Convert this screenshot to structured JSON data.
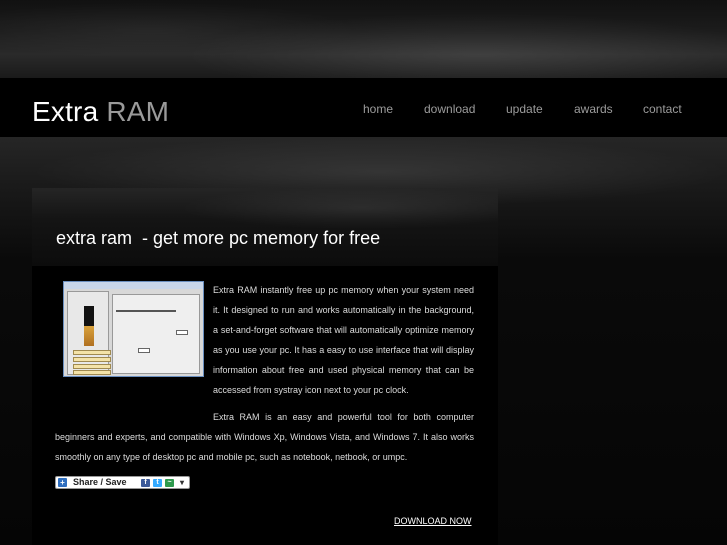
{
  "header": {
    "logo_part1": "Extra",
    "logo_part2": "RAM",
    "nav": [
      {
        "label": "home"
      },
      {
        "label": "download"
      },
      {
        "label": "update"
      },
      {
        "label": "awards"
      },
      {
        "label": "contact"
      }
    ]
  },
  "main": {
    "title": "extra ram  - get more pc memory for free",
    "paragraph1": "Extra RAM instantly free up pc memory when your system need it. It designed to run and works automatically in the background, a set-and-forget software that will automatically optimize memory as you use your pc. It has a easy to use interface that will display information about free and used physical memory that can be accessed from systray icon next to your pc clock.",
    "paragraph2_lead": "Extra RAM is an easy and powerful tool for both computer",
    "paragraph2_rest": "beginners and experts, and compatible with Windows Xp, Windows Vista, and Windows 7. It also works smoothly on any type of desktop pc and mobile pc, such as notebook, netbook, or umpc.",
    "share_label": "Share / Save",
    "download_link": "DOWNLOAD NOW",
    "screenshot_icon": "app-screenshot"
  },
  "colors": {
    "background": "#000000",
    "logo_accent": "#9a9a9a",
    "nav_text": "#9c9c9c",
    "body_text": "#dcdcdc"
  }
}
